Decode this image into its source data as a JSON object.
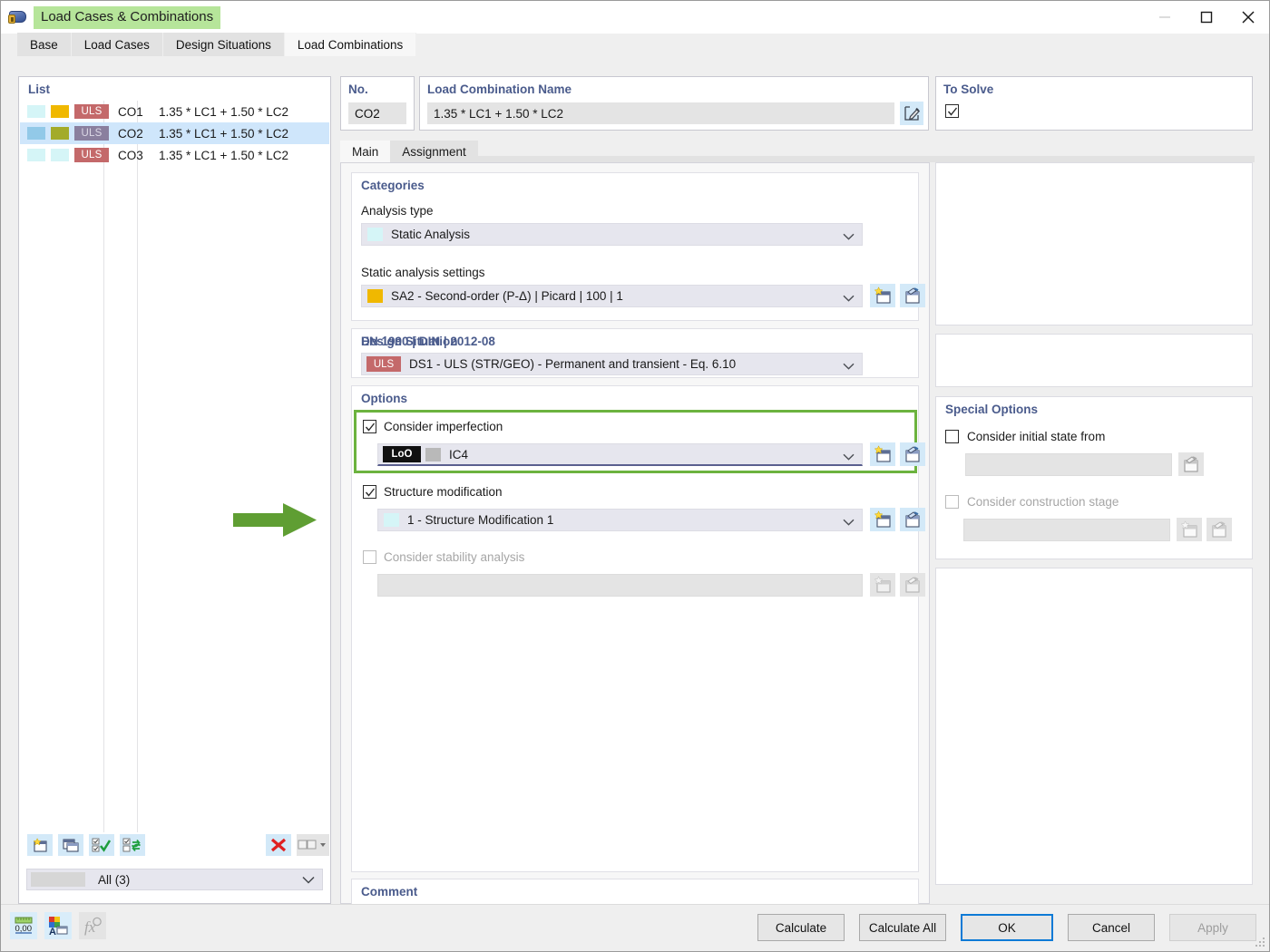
{
  "window": {
    "title": "Load Cases & Combinations",
    "icon": "load-combinations-icon",
    "minimize": "minimize-icon",
    "maximize": "maximize-icon",
    "close": "close-icon"
  },
  "tabs": [
    {
      "label": "Base",
      "active": false
    },
    {
      "label": "Load Cases",
      "active": false
    },
    {
      "label": "Design Situations",
      "active": false
    },
    {
      "label": "Load Combinations",
      "active": true
    }
  ],
  "list": {
    "legend": "List",
    "rows": [
      {
        "color1": "#d5f5f7",
        "color2": "#f0b800",
        "tag": "ULS",
        "no": "CO1",
        "formula": "1.35 * LC1 + 1.50 * LC2",
        "selected": false
      },
      {
        "color1": "#92c9e8",
        "color2": "#a3ab2a",
        "tag": "ULS",
        "no": "CO2",
        "formula": "1.35 * LC1 + 1.50 * LC2",
        "selected": true
      },
      {
        "color1": "#d5f5f7",
        "color2": "#d5f5f7",
        "tag": "ULS",
        "no": "CO3",
        "formula": "1.35 * LC1 + 1.50 * LC2",
        "selected": false
      }
    ],
    "toolbar": [
      {
        "name": "new-item-button",
        "icon": "new-window-icon"
      },
      {
        "name": "copy-item-button",
        "icon": "copy-window-icon"
      },
      {
        "name": "select-all-button",
        "icon": "check-all-icon"
      },
      {
        "name": "invert-selection-button",
        "icon": "invert-selection-icon"
      },
      {
        "name": "delete-item-button",
        "icon": "red-x-icon"
      },
      {
        "name": "view-mode-button",
        "icon": "two-pane-icon"
      }
    ],
    "filter": {
      "label": "All (3)",
      "swatch": "#d6d6d6"
    }
  },
  "no_box": {
    "legend": "No.",
    "value": "CO2"
  },
  "name_box": {
    "legend": "Load Combination Name",
    "value": "1.35 * LC1 + 1.50 * LC2",
    "edit_button": "edit-pencil-icon"
  },
  "to_solve": {
    "legend": "To Solve",
    "checked": true
  },
  "inner_tabs": [
    {
      "label": "Main",
      "active": true
    },
    {
      "label": "Assignment",
      "active": false
    }
  ],
  "categories": {
    "legend": "Categories",
    "analysis_type_label": "Analysis type",
    "analysis_type_value": "Static Analysis",
    "analysis_type_swatch": "#d5f5f7",
    "settings_label": "Static analysis settings",
    "settings_value": "SA2 - Second-order (P-Δ) | Picard | 100 | 1",
    "settings_swatch": "#f0b800"
  },
  "design_situation": {
    "legend": "Design Situation",
    "standard": "EN 1990 | DIN | 2012-08",
    "badge": "ULS",
    "value": "DS1 - ULS (STR/GEO) - Permanent and transient - Eq. 6.10"
  },
  "options": {
    "legend": "Options",
    "imperfection": {
      "label": "Consider imperfection",
      "checked": true,
      "badge": "LoO",
      "swatch": "#b9b9b9",
      "value": "IC4",
      "highlighted": true
    },
    "structure_modification": {
      "label": "Structure modification",
      "checked": true,
      "swatch": "#d5f5f7",
      "value": "1 - Structure Modification 1"
    },
    "stability_analysis": {
      "label": "Consider stability analysis",
      "checked": false,
      "disabled": true,
      "value": ""
    }
  },
  "special_options": {
    "legend": "Special Options",
    "initial_state": {
      "label": "Consider initial state from",
      "checked": false,
      "value": ""
    },
    "construction_stage": {
      "label": "Consider construction stage",
      "checked": false,
      "disabled": true,
      "value": ""
    }
  },
  "comment": {
    "legend": "Comment",
    "value": ""
  },
  "footer": {
    "tools": [
      {
        "name": "units-button",
        "icon": "units-0-00-icon",
        "disabled": false
      },
      {
        "name": "display-properties-button",
        "icon": "color-palette-icon",
        "disabled": false
      },
      {
        "name": "formula-button",
        "icon": "fx-icon",
        "disabled": true
      }
    ],
    "buttons": [
      {
        "label": "Calculate",
        "name": "calculate-button",
        "primary": false,
        "disabled": false
      },
      {
        "label": "Calculate All",
        "name": "calculate-all-button",
        "primary": false,
        "disabled": false
      },
      {
        "label": "OK",
        "name": "ok-button",
        "primary": true,
        "disabled": false
      },
      {
        "label": "Cancel",
        "name": "cancel-button",
        "primary": false,
        "disabled": false
      },
      {
        "label": "Apply",
        "name": "apply-button",
        "primary": false,
        "disabled": true
      }
    ]
  },
  "annotation": {
    "arrow_color": "#6cb33f",
    "highlight_color": "#6cb33f"
  }
}
